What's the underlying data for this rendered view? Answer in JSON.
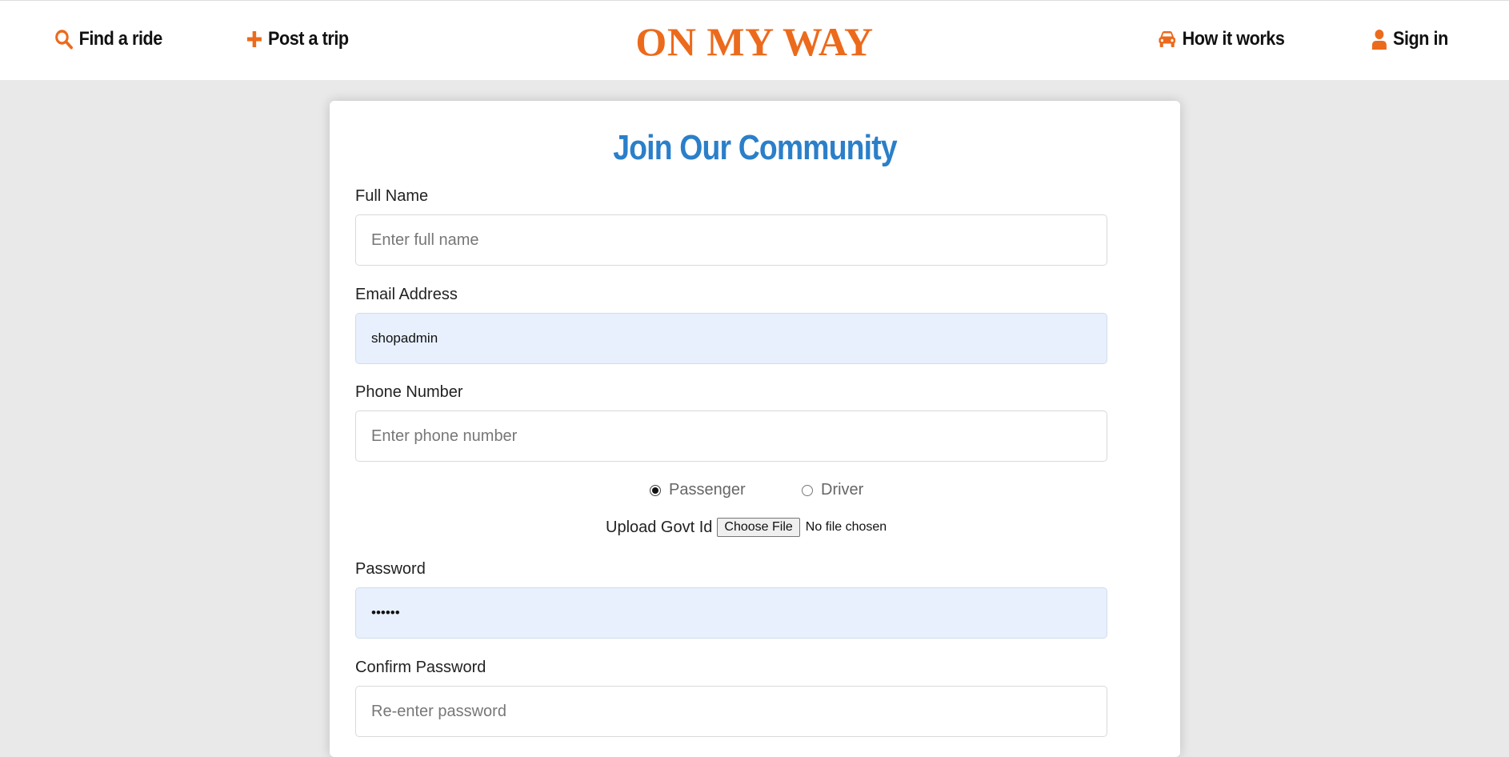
{
  "nav": {
    "find_ride": "Find a ride",
    "post_trip": "Post a trip",
    "brand": "ON MY WAY",
    "how_it_works": "How it works",
    "sign_in": "Sign in",
    "icon_color": "#ec6a1c"
  },
  "form": {
    "title": "Join Our Community",
    "full_name": {
      "label": "Full Name",
      "placeholder": "Enter full name",
      "value": ""
    },
    "email": {
      "label": "Email Address",
      "value": "shopadmin"
    },
    "phone": {
      "label": "Phone Number",
      "placeholder": "Enter phone number",
      "value": ""
    },
    "roles": [
      {
        "label": "Passenger",
        "checked": true
      },
      {
        "label": "Driver",
        "checked": false
      }
    ],
    "upload": {
      "label": "Upload Govt Id",
      "button": "Choose File",
      "status": "No file chosen"
    },
    "password": {
      "label": "Password",
      "value": "••••••"
    },
    "confirm_password": {
      "label": "Confirm Password",
      "placeholder": "Re-enter password"
    }
  }
}
